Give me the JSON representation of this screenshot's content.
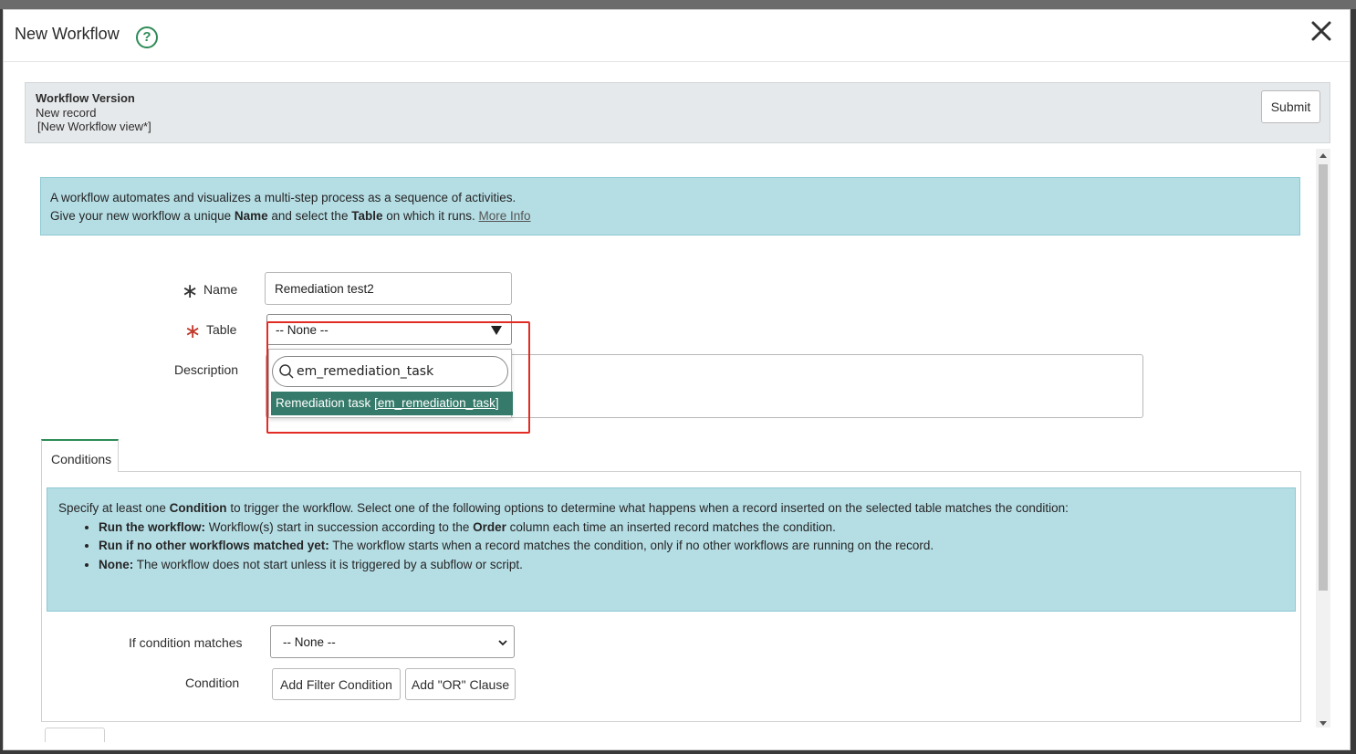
{
  "modal": {
    "title": "New Workflow"
  },
  "record_header": {
    "title": "Workflow Version",
    "subtitle": "New record",
    "view": "[New Workflow view*]",
    "submit_label": "Submit"
  },
  "intro": {
    "line1": "A workflow automates and visualizes a multi-step process as a sequence of activities.",
    "line2_pre": "Give your new workflow a unique ",
    "line2_name": "Name",
    "line2_mid": " and select the ",
    "line2_table": "Table",
    "line2_post": " on which it runs. ",
    "more_info": "More Info"
  },
  "form": {
    "name_label": "Name",
    "name_value": "Remediation test2",
    "table_label": "Table",
    "table_value": "-- None --",
    "description_label": "Description"
  },
  "table_dropdown": {
    "search_value": "em_remediation_task",
    "option_label": "Remediation task ",
    "option_sysname": "[em_remediation_task]"
  },
  "tabs": {
    "conditions": "Conditions"
  },
  "conditions_info": {
    "intro_pre": "Specify at least one ",
    "intro_bold": "Condition",
    "intro_post": " to trigger the workflow. Select one of the following options to determine what happens when a record inserted on the selected table matches the condition:",
    "b1_bold": "Run the workflow:",
    "b1_pre": " Workflow(s) start in succession according to the ",
    "b1_order": "Order",
    "b1_post": " column each time an inserted record matches the condition.",
    "b2_bold": "Run if no other workflows matched yet:",
    "b2_text": " The workflow starts when a record matches the condition, only if no other workflows are running on the record.",
    "b3_bold": "None:",
    "b3_text": " The workflow does not start unless it is triggered by a subflow or script."
  },
  "condition_form": {
    "if_label": "If condition matches",
    "if_value": "-- None --",
    "condition_label": "Condition",
    "add_filter": "Add Filter Condition",
    "add_or": "Add \"OR\" Clause"
  },
  "colors": {
    "accent": "#2e8b57",
    "info_bg": "#b5dde4",
    "option_bg": "#357a6a",
    "highlight": "#e32b25"
  }
}
